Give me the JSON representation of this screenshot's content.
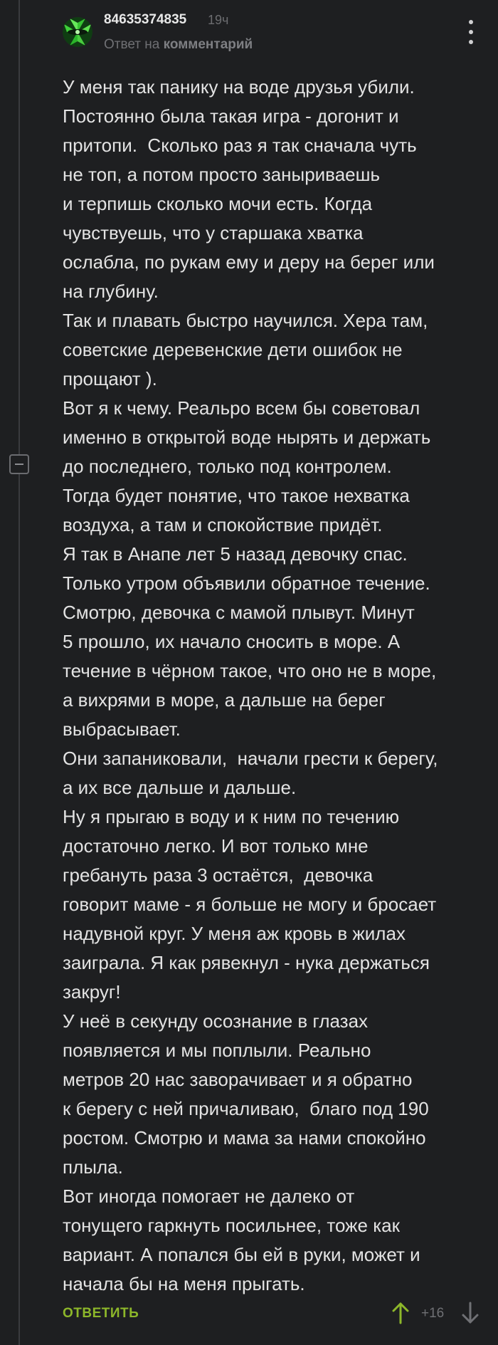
{
  "comment": {
    "author": "84635374835",
    "time": "19ч",
    "reply_prefix": "Ответ на",
    "reply_target": "комментарий",
    "body": "У меня так панику на воде друзья убили.\nПостоянно была такая игра - догонит и\nпритопи.  Сколько раз я так сначала чуть\nне топ, а потом просто заныриваешь\nи терпишь сколько мочи есть. Когда\nчувствуешь, что у старшака хватка\nослабла, по рукам ему и деру на берег или\nна глубину.\nТак и плавать быстро научился. Хера там,\nсоветские деревенские дети ошибок не\nпрощают ).\nВот я к чему. Реальро всем бы советовал\nименно в открытой воде нырять и держать\nдо последнего, только под контролем.\nТогда будет понятие, что такое нехватка\nвоздуха, а там и спокойствие придёт.\nЯ так в Анапе лет 5 назад девочку спас.\nТолько утром объявили обратное течение.\nСмотрю, девочка с мамой плывут. Минут\n5 прошло, их начало сносить в море. А\nтечение в чёрном такое, что оно не в море,\nа вихрями в море, а дальше на берег\nвыбрасывает.\nОни запаниковали,  начали грести к берегу,\nа их все дальше и дальше.\nНу я прыгаю в воду и к ним по течению\nдостаточно легко. И вот только мне\nгребануть раза 3 остаётся,  девочка\nговорит маме - я больше не могу и бросает\nнадувной круг. У меня аж кровь в жилах\nзаиграла. Я как рявекнул - нука держаться\nзакруг!\nУ неё в секунду осознание в глазах\nпоявляется и мы поплыли. Реально\nметров 20 нас заворачивает и я обратно\nк берегу с ней причаливаю,  благо под 190\nростом. Смотрю и мама за нами спокойно\nплыла.\nВот иногда помогает не далеко от\nтонущего гаркнуть посильнее, тоже как\nвариант. А попался бы ей в руки, может и\nначала бы на меня прыгать."
  },
  "actions": {
    "reply_label": "ОТВЕТИТЬ",
    "rating": "+16",
    "upvote_icon": "arrow-up-icon",
    "downvote_icon": "arrow-down-icon",
    "more_icon": "vertical-dots-icon",
    "collapse_icon": "minus-square-icon"
  },
  "colors": {
    "background": "#1e1f21",
    "accent": "#8db72a",
    "muted": "#6f7074",
    "text": "#e3e3e3"
  }
}
